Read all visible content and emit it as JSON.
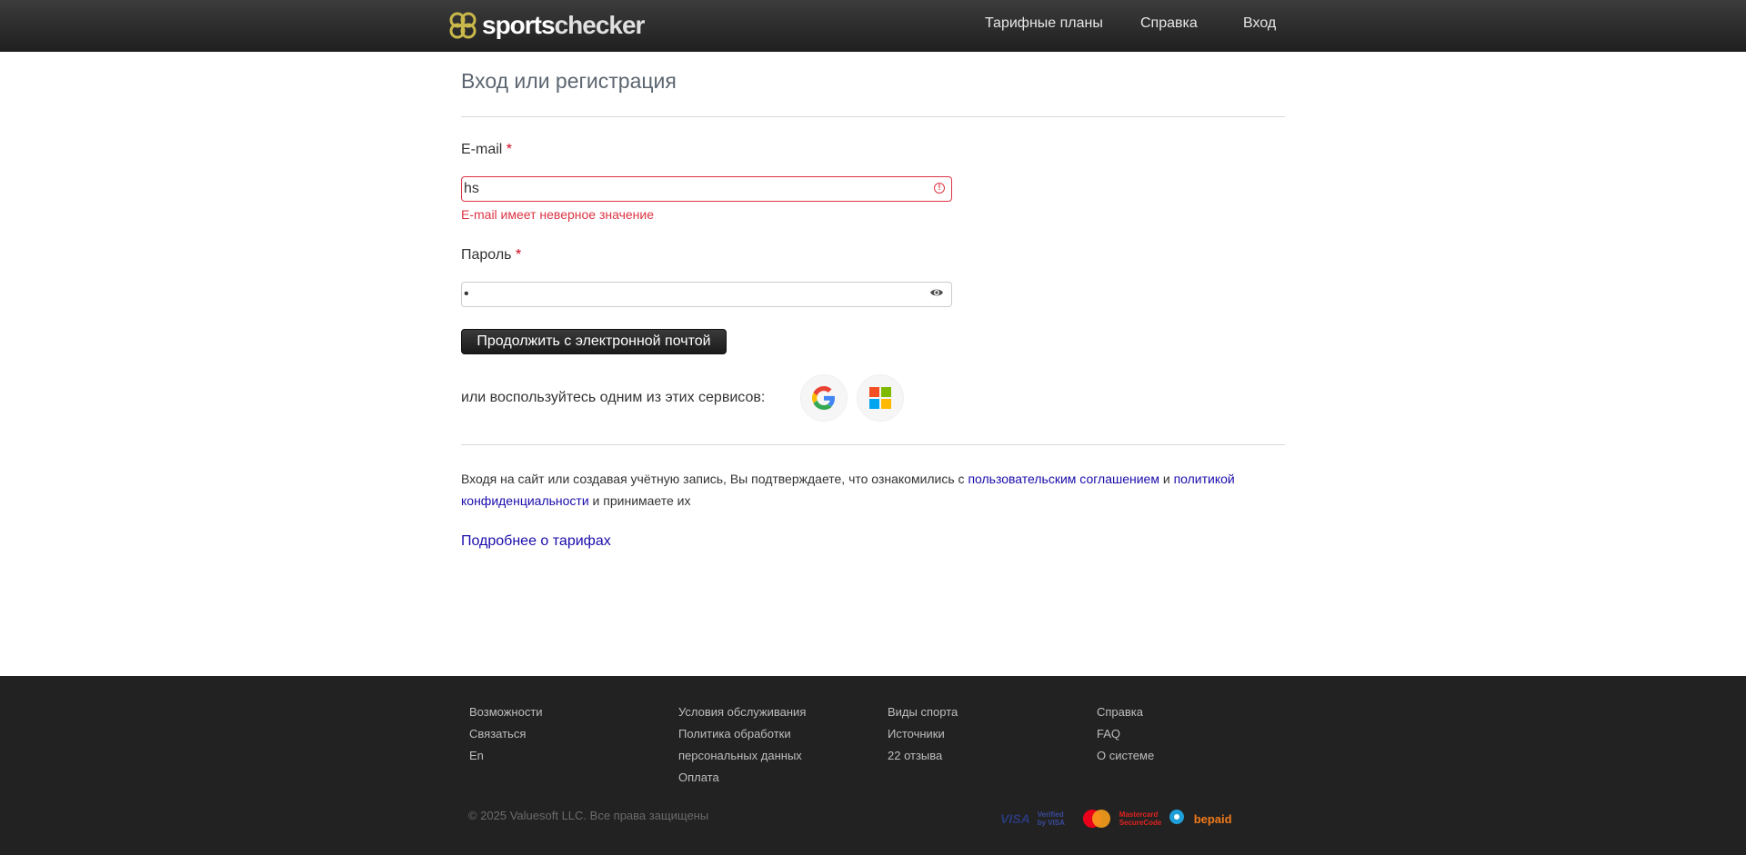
{
  "header": {
    "logo_part1": "sports",
    "logo_part2": "checker",
    "nav": [
      "Тарифные планы",
      "Справка",
      "Вход"
    ]
  },
  "main": {
    "title": "Вход или регистрация",
    "email_label": "E-mail",
    "required_mark": "*",
    "email_value": "hs",
    "email_error": "E-mail имеет неверное значение",
    "password_label": "Пароль",
    "password_value": "•",
    "submit_label": "Продолжить с электронной почтой",
    "oauth_text": "или воспользуйтесь одним из этих сервисов:",
    "consent_prefix": "Входя на сайт или создавая учётную запись, Вы подтверждаете, что ознакомились с ",
    "consent_link1": "пользовательским соглашением",
    "consent_mid": " и ",
    "consent_link2": "политикой конфиденциальности",
    "consent_suffix": " и принимаете их",
    "more_link": "Подробнее о тарифах"
  },
  "footer": {
    "col1": [
      "Возможности",
      "Связаться",
      "En"
    ],
    "col2": [
      "Условия обслуживания",
      "Политика обработки персональных данных",
      "Оплата"
    ],
    "col3": [
      "Виды спорта",
      "Источники",
      "22 отзыва"
    ],
    "col4": [
      "Справка",
      "FAQ",
      "О системе"
    ],
    "copyright": "© 2025 Valuesoft LLC. Все права защищены",
    "payments": [
      "VISA",
      "Verified by VISA",
      "Mastercard",
      "Mastercard SecureCode",
      "Connectpay",
      "bepaid"
    ]
  },
  "colors": {
    "error": "#dc3545",
    "link": "#1a0dab",
    "header_bg": "#2b2b2b",
    "footer_bg": "#222222"
  }
}
